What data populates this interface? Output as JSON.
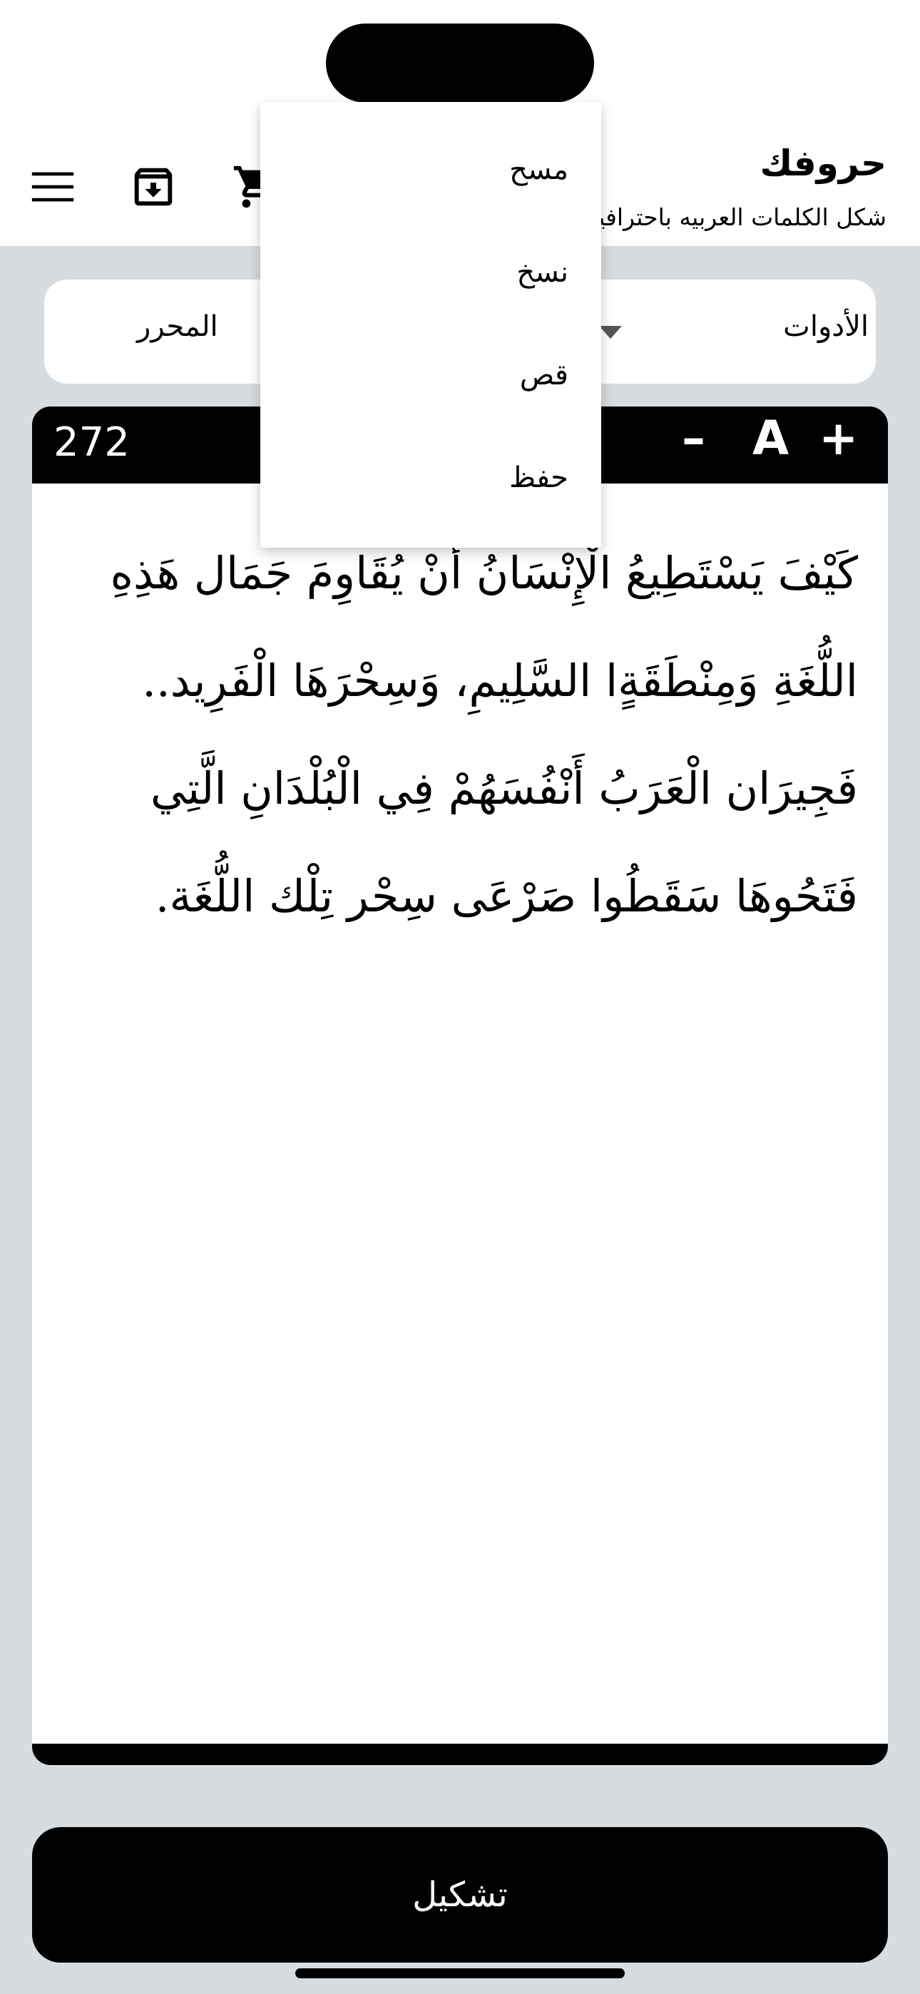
{
  "header": {
    "title": "حروفك",
    "subtitle": "شكل الكلمات العربيه باحترافية",
    "icons": [
      "menu-icon",
      "archive-download-icon",
      "cart-icon"
    ]
  },
  "toolbar": {
    "tools_label": "الأدوات",
    "editor_label": "المحرر"
  },
  "editor": {
    "char_count": "272",
    "font_increase": "+",
    "font_label": "A",
    "font_decrease": "–",
    "lines": [
      "كَيْفَ يَسْتَطِيعُ الْإِنْسَانُ أَنْ يُقَاوِمَ جَمَال هَذِهِ",
      "اللُّغَةِ وَمِنْطَقَةٍا السَّلِيمِ، وَسِحْرَهَا الْفَرِيد..",
      "فَجِيرَان الْعَرَبُ أَنْفُسَهُمْ فِي الْبُلْدَانِ الَّتِي",
      "فَتَحُوهَا سَقَطُوا صَرْعَى سِحْر تِلْك اللُّغَة."
    ]
  },
  "dropdown": {
    "items": [
      "مسح",
      "نسخ",
      "قص",
      "حفظ"
    ]
  },
  "action": {
    "vowelize_label": "تشكيل"
  },
  "colors": {
    "background": "#d7dce0",
    "card": "#ffffff",
    "accent": "#000000"
  }
}
